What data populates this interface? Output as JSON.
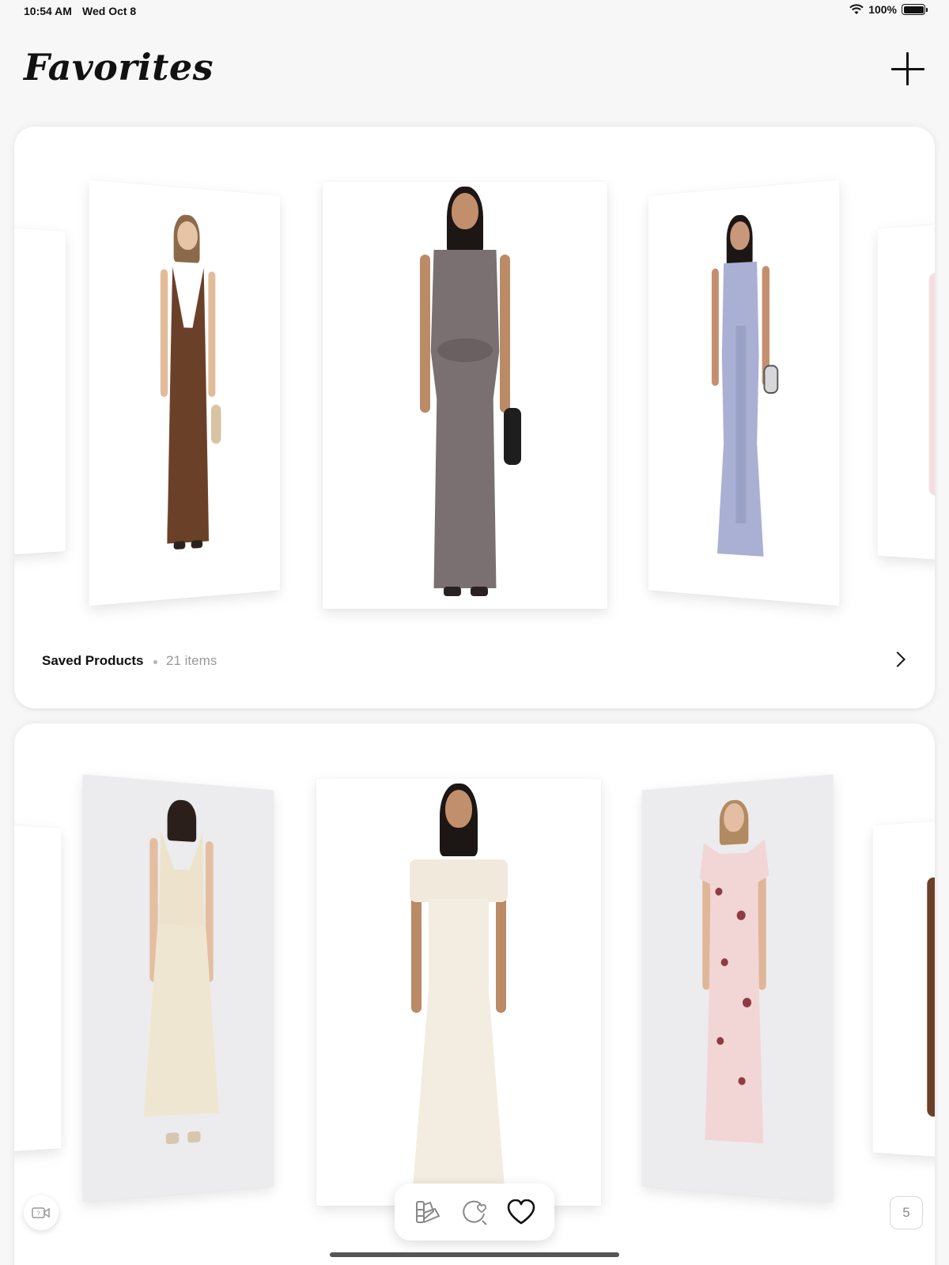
{
  "status_bar": {
    "time": "10:54 AM",
    "date": "Wed Oct 8",
    "battery": "100%",
    "icons": [
      "wifi-icon",
      "battery-icon"
    ]
  },
  "header": {
    "title": "Favorites",
    "add_icon": "plus-icon"
  },
  "collections": [
    {
      "title": "Saved Products",
      "count": "21 items",
      "products": [
        {
          "description": "brown halter maxi dress",
          "color": "#6b4029"
        },
        {
          "description": "taupe twist-front maxi dress",
          "color": "#7a7072"
        },
        {
          "description": "lavender ruffle gown",
          "color": "#a9b0d4"
        }
      ]
    },
    {
      "products": [
        {
          "description": "cream eyelet midi dress",
          "color": "#efe6d2"
        },
        {
          "description": "ivory off-shoulder maxi dress",
          "color": "#f3ece0"
        },
        {
          "description": "pink floral flutter-sleeve dress",
          "color": "#f2d6d6"
        }
      ]
    }
  ],
  "bottom_controls": {
    "tabs": [
      "palette-icon",
      "refresh-heart-icon",
      "heart-icon"
    ],
    "active_tab": "heart-icon",
    "page_count": "5"
  }
}
